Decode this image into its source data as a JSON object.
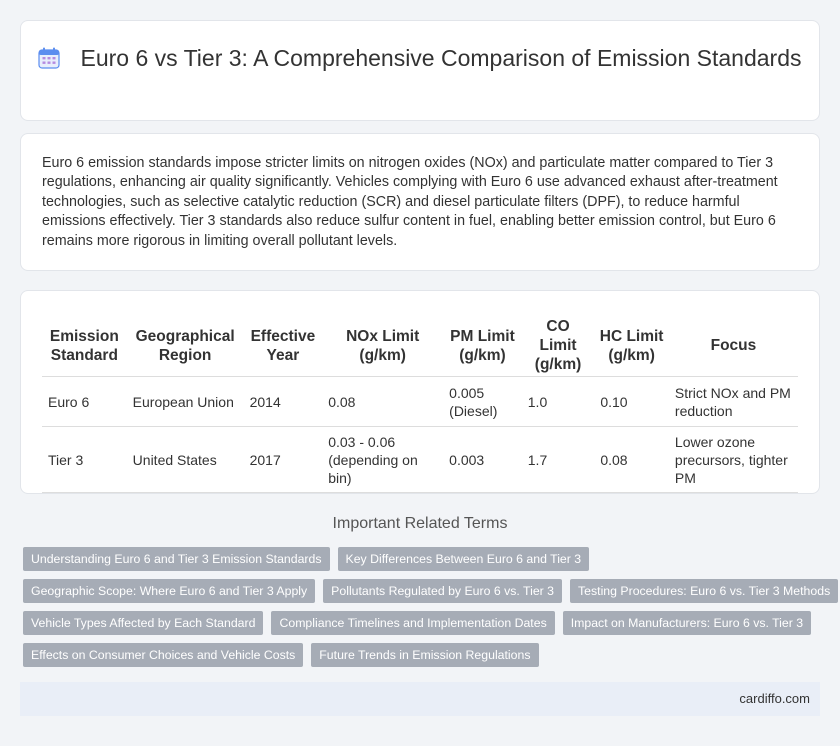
{
  "header": {
    "title": "Euro 6 vs Tier 3: A Comprehensive Comparison of Emission Standards",
    "icon": "calendar-icon",
    "icon_color": "#5b8def"
  },
  "intro": {
    "text": "Euro 6 emission standards impose stricter limits on nitrogen oxides (NOx) and particulate matter compared to Tier 3 regulations, enhancing air quality significantly. Vehicles complying with Euro 6 use advanced exhaust after-treatment technologies, such as selective catalytic reduction (SCR) and diesel particulate filters (DPF), to reduce harmful emissions effectively. Tier 3 standards also reduce sulfur content in fuel, enabling better emission control, but Euro 6 remains more rigorous in limiting overall pollutant levels."
  },
  "table": {
    "headers": [
      "Emission Standard",
      "Geographical Region",
      "Effective Year",
      "NOx Limit (g/km)",
      "PM Limit (g/km)",
      "CO Limit (g/km)",
      "HC Limit (g/km)",
      "Focus"
    ],
    "rows": [
      [
        "Euro 6",
        "European Union",
        "2014",
        "0.08",
        "0.005 (Diesel)",
        "1.0",
        "0.10",
        "Strict NOx and PM reduction"
      ],
      [
        "Tier 3",
        "United States",
        "2017",
        "0.03 - 0.06 (depending on bin)",
        "0.003",
        "1.7",
        "0.08",
        "Lower ozone precursors, tighter PM"
      ]
    ]
  },
  "related": {
    "title": "Important Related Terms",
    "tags": [
      "Understanding Euro 6 and Tier 3 Emission Standards",
      "Key Differences Between Euro 6 and Tier 3",
      "Geographic Scope: Where Euro 6 and Tier 3 Apply",
      "Pollutants Regulated by Euro 6 vs. Tier 3",
      "Testing Procedures: Euro 6 vs. Tier 3 Methods",
      "Vehicle Types Affected by Each Standard",
      "Compliance Timelines and Implementation Dates",
      "Impact on Manufacturers: Euro 6 vs. Tier 3",
      "Effects on Consumer Choices and Vehicle Costs",
      "Future Trends in Emission Regulations"
    ]
  },
  "footer": {
    "text": "cardiffo.com"
  }
}
